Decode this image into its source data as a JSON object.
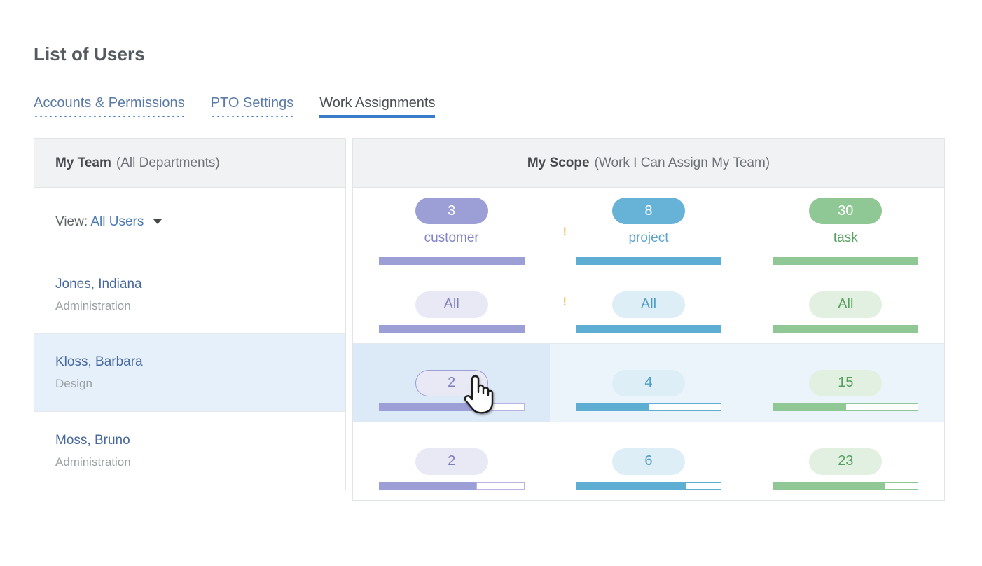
{
  "page_title": "List of Users",
  "tabs": [
    {
      "label": "Accounts & Permissions",
      "active": false
    },
    {
      "label": "PTO Settings",
      "active": false
    },
    {
      "label": "Work Assignments",
      "active": true
    }
  ],
  "left_panel": {
    "header_bold": "My Team",
    "header_sub": "(All Departments)",
    "view_label": "View:",
    "view_value": "All Users",
    "caret_icon": "chevron-down-icon",
    "users": [
      {
        "name": "Jones, Indiana",
        "dept": "Administration"
      },
      {
        "name": "Kloss, Barbara",
        "dept": "Design"
      },
      {
        "name": "Moss, Bruno",
        "dept": "Administration"
      }
    ]
  },
  "right_panel": {
    "header_bold": "My Scope",
    "header_sub": "(Work I Can Assign My Team)",
    "warn_icon": "warning-exclamation-icon",
    "columns": [
      {
        "label": "customer",
        "total": "3",
        "color": "#9c9ed6"
      },
      {
        "label": "project",
        "total": "8",
        "color": "#67b2d7"
      },
      {
        "label": "task",
        "total": "30",
        "color": "#8fc795"
      }
    ],
    "rows": [
      {
        "user": "Jones, Indiana",
        "cells": [
          {
            "value": "All",
            "percent": 100
          },
          {
            "value": "All",
            "percent": 100
          },
          {
            "value": "All",
            "percent": 100
          }
        ]
      },
      {
        "user": "Kloss, Barbara",
        "cells": [
          {
            "value": "2",
            "percent": 67
          },
          {
            "value": "4",
            "percent": 50
          },
          {
            "value": "15",
            "percent": 50
          }
        ]
      },
      {
        "user": "Moss, Bruno",
        "cells": [
          {
            "value": "2",
            "percent": 67
          },
          {
            "value": "6",
            "percent": 75
          },
          {
            "value": "23",
            "percent": 77
          }
        ]
      }
    ]
  },
  "cursor": {
    "icon": "pointing-hand-cursor"
  }
}
